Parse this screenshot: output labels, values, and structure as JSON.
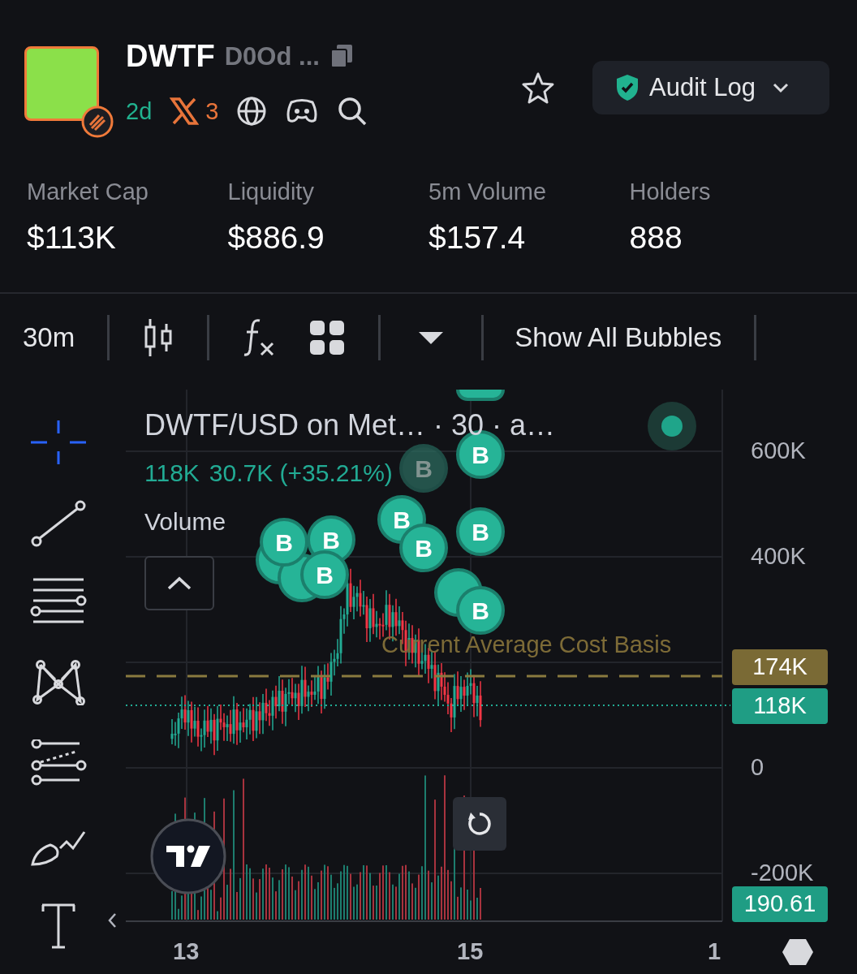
{
  "token": {
    "symbol": "DWTF",
    "address": "D0Od ...",
    "age": "2d",
    "x_count": "3"
  },
  "audit_button": {
    "label": "Audit Log"
  },
  "stats": [
    {
      "label": "Market Cap",
      "value": "$113K"
    },
    {
      "label": "Liquidity",
      "value": "$886.9"
    },
    {
      "label": "5m Volume",
      "value": "$157.4"
    },
    {
      "label": "Holders",
      "value": "888"
    }
  ],
  "toolbar": {
    "interval": "30m",
    "bubbles_button": "Show All Bubbles"
  },
  "chart": {
    "title": "DWTF/USD on Met… · 30 · a…",
    "price": "118K",
    "change": "30.7K (+35.21%)",
    "volume_label": "Volume",
    "y_labels": [
      "600K",
      "400K",
      "0",
      "-200K"
    ],
    "x_labels": [
      "13",
      "15",
      "1"
    ],
    "cost_basis_label": "Current Average Cost Basis",
    "cost_basis_tag": "174K",
    "price_tag": "118K",
    "volume_tag": "190.61",
    "bubbles": [
      {
        "letter": "B",
        "faded": true
      },
      {
        "letter": "B",
        "faded": false
      },
      {
        "letter": "B",
        "faded": false
      },
      {
        "letter": "B",
        "faded": false
      },
      {
        "letter": "B",
        "faded": false
      },
      {
        "letter": "B",
        "faded": false
      },
      {
        "letter": "B",
        "faded": false
      },
      {
        "letter": "B",
        "faded": false
      },
      {
        "letter": "B",
        "faded": false
      }
    ]
  }
}
